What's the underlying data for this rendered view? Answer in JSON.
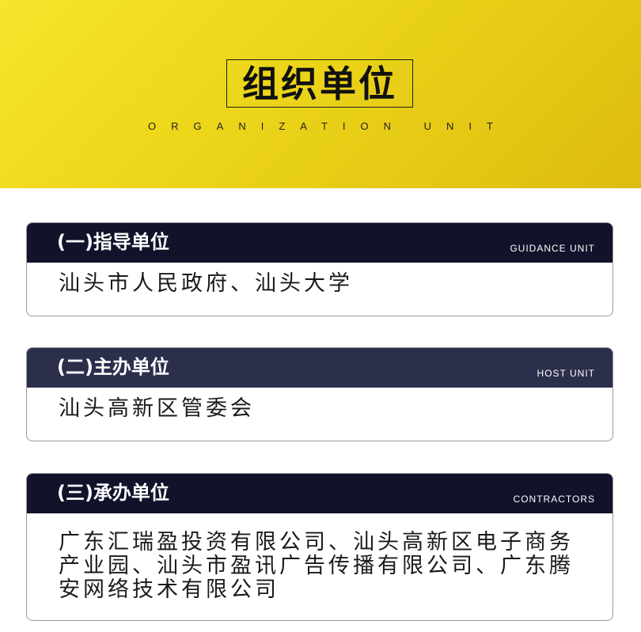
{
  "header": {
    "title": "组织单位",
    "subtitle": "ORGANIZATION UNIT"
  },
  "colors": {
    "banner": "#efd720",
    "card_head_dark": "#10132a",
    "card_head_mid": "#2b2f4c"
  },
  "sections": [
    {
      "title": "(一)指导单位",
      "en_label": "GUIDANCE UNIT",
      "lines": [
        "汕头市人民政府、汕头大学"
      ]
    },
    {
      "title": "(二)主办单位",
      "en_label": "HOST UNIT",
      "lines": [
        "汕头高新区管委会"
      ]
    },
    {
      "title": "(三)承办单位",
      "en_label": "CONTRACTORS",
      "lines": [
        "广东汇瑞盈投资有限公司、汕头高新区电子商务",
        "产业园、汕头市盈讯广告传播有限公司、广东腾",
        "安网络技术有限公司"
      ]
    }
  ]
}
